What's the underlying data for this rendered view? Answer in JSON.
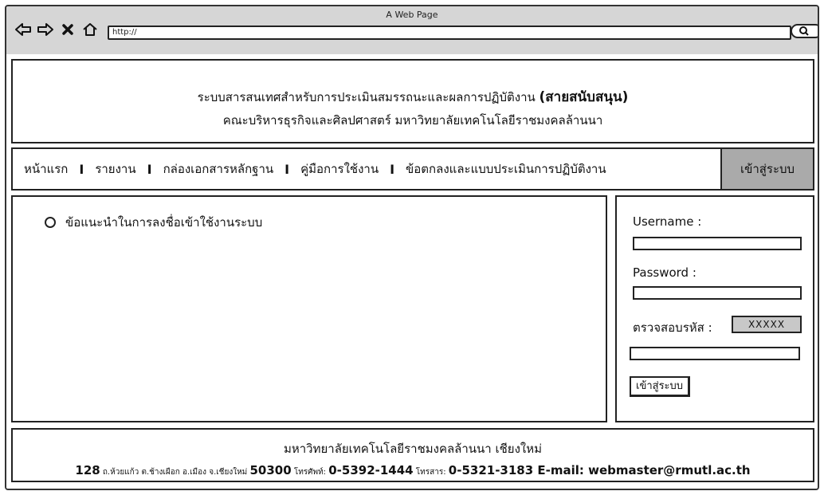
{
  "window": {
    "title": "A Web Page",
    "url": "http://"
  },
  "header": {
    "line1": "ระบบสารสนเทศสำหรับการประเมินสมรรถนะและผลการปฏิบัติงาน",
    "line1_bold": "(สายสนับสนุน)",
    "line2": "คณะบริหารธุรกิจและศิลปศาสตร์ มหาวิทยาลัยเทคโนโลยีราชมงคลล้านนา"
  },
  "menu": {
    "items": [
      "หน้าแรก",
      "รายงาน",
      "กล่องเอกสารหลักฐาน",
      "คู่มือการใช้งาน",
      "ข้อตกลงและแบบประเมินการปฏิบัติงาน"
    ],
    "separator": "I",
    "login_tab": "เข้าสู่ระบบ"
  },
  "content": {
    "bullet_text": "ข้อแนะนำในการลงชื่อเข้าใช้งานระบบ"
  },
  "login": {
    "username_label": "Username :",
    "username_value": "",
    "password_label": "Password :",
    "password_value": "",
    "captcha_label": "ตรวจสอบรหัส :",
    "captcha_code": "XXXXX",
    "captcha_value": "",
    "submit_label": "เข้าสู่ระบบ"
  },
  "footer": {
    "line1": "มหาวิทยาลัยเทคโนโลยีราชมงคลล้านนา เชียงใหม่",
    "addr_num": "128",
    "addr_text": " ถ.ห้วยแก้ว ต.ช้างเผือก อ.เมือง จ.เชียงใหม่ ",
    "zip": "50300",
    "tel_label": " โทรศัพท์: ",
    "tel": "0-5392-1444",
    "fax_label": " โทรสาร: ",
    "fax": "0-5321-3183",
    "email": " E-mail: webmaster@rmutl.ac.th"
  }
}
